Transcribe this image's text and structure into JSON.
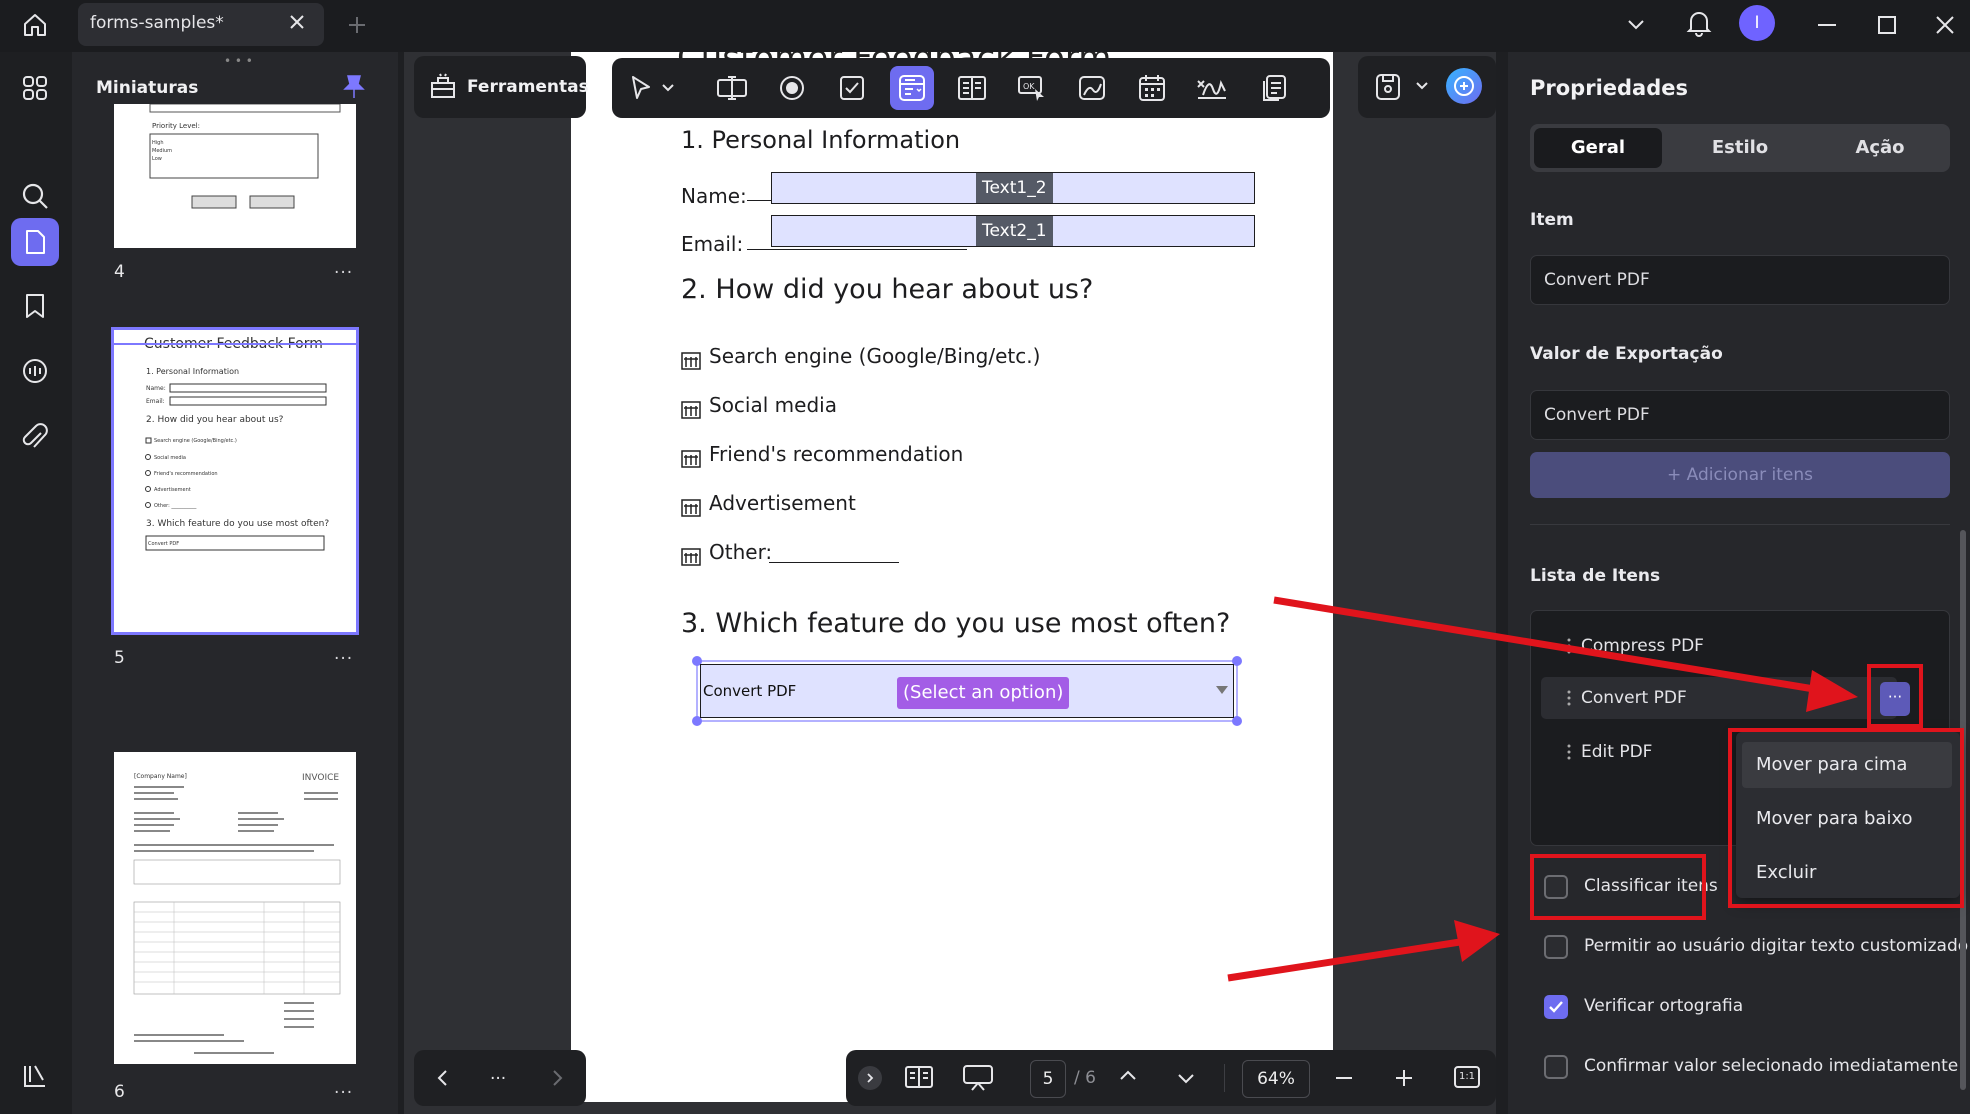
{
  "window": {
    "tab_title": "forms-samples*"
  },
  "thumbnails": {
    "title": "Miniaturas",
    "pages": [
      {
        "number": "4",
        "more": "..."
      },
      {
        "number": "5",
        "more": "...",
        "selected": true
      },
      {
        "number": "6",
        "more": "..."
      }
    ]
  },
  "toolbar": {
    "ferramentas_label": "Ferramentas"
  },
  "document": {
    "title": "Customer Feedback Form",
    "section1": "1. Personal Information",
    "name_label": "Name: ",
    "email_label": "Email: ",
    "name_field_tag": "Text1_2",
    "email_field_tag": "Text2_1",
    "section2": "2. How did you hear about us?",
    "options": [
      "Search engine (Google/Bing/etc.)",
      "Social media",
      "Friend's recommendation",
      "Advertisement",
      "Other: "
    ],
    "section3": "3. Which feature do you use most often?",
    "dropdown_value": "Convert PDF",
    "dropdown_placeholder": "(Select an option)"
  },
  "navigation": {
    "more": "...",
    "current_page": "5",
    "total_pages": "/ 6",
    "zoom": "64%",
    "fit_label": "1:1"
  },
  "properties": {
    "title": "Propriedades",
    "tabs": [
      "Geral",
      "Estilo",
      "Ação"
    ],
    "active_tab": "Geral",
    "item_label": "Item",
    "item_value": "Convert PDF",
    "export_label": "Valor de Exportação",
    "export_value": "Convert PDF",
    "add_items": "+ Adicionar itens",
    "list_label": "Lista de Itens",
    "list_items": [
      "Compress PDF",
      "Convert PDF",
      "Edit PDF"
    ],
    "row_more": "···",
    "context_menu": [
      "Mover para cima",
      "Mover para baixo",
      "Excluir"
    ],
    "checkboxes": [
      {
        "label": "Classificar itens",
        "checked": false
      },
      {
        "label": "Permitir ao usuário digitar texto customizado",
        "checked": false
      },
      {
        "label": "Verificar ortografia",
        "checked": true
      },
      {
        "label": "Confirmar valor selecionado imediatamente",
        "checked": false
      }
    ]
  },
  "colors": {
    "accent": "#6e6cf0",
    "annotation_red": "#e0141c",
    "field_fill": "#dfe2ff",
    "dropdown_pill": "#a35de6"
  }
}
